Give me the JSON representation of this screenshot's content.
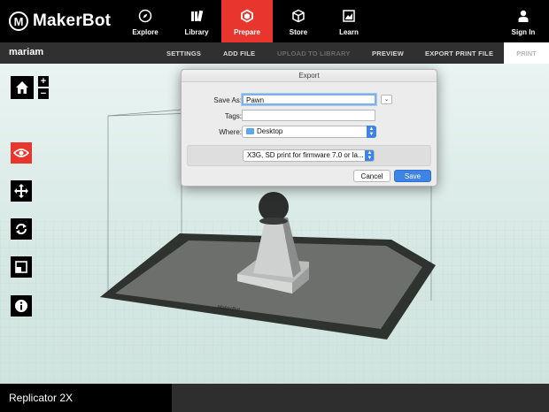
{
  "brand": {
    "name": "MakerBot"
  },
  "nav": [
    {
      "label": "Explore",
      "icon": "compass-icon"
    },
    {
      "label": "Library",
      "icon": "library-icon"
    },
    {
      "label": "Prepare",
      "icon": "prepare-cube-icon",
      "active": true
    },
    {
      "label": "Store",
      "icon": "store-cube-icon"
    },
    {
      "label": "Learn",
      "icon": "learn-book-icon"
    },
    {
      "label": "Sign In",
      "icon": "person-icon"
    }
  ],
  "subbar": {
    "username": "mariam",
    "settings": "SETTINGS",
    "add_file": "ADD FILE",
    "upload": "UPLOAD TO LIBRARY",
    "preview": "PREVIEW",
    "export": "EXPORT PRINT FILE",
    "print": "PRINT"
  },
  "tools": {
    "zoom_in": "+",
    "zoom_out": "−"
  },
  "dialog": {
    "title": "Export",
    "save_as_label": "Save As:",
    "save_as_value": "Pawn",
    "tags_label": "Tags:",
    "tags_value": "",
    "where_label": "Where:",
    "where_value": "Desktop",
    "format_value": "X3G, SD print for firmware 7.0 or la...",
    "cancel": "Cancel",
    "save": "Save"
  },
  "plate_label": "MakerBot",
  "printer_name": "Replicator 2X",
  "colors": {
    "accent": "#e8362f",
    "mac_blue": "#3e84e5"
  }
}
